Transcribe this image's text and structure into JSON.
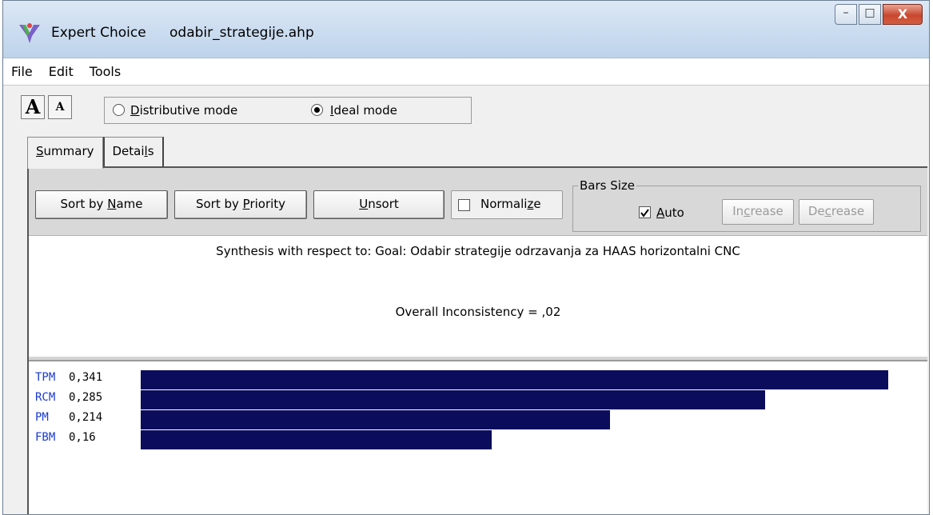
{
  "window": {
    "app_name": "Expert Choice",
    "file_name": "odabir_strategije.ahp",
    "minimize_glyph": "–",
    "maximize_glyph": "□",
    "close_glyph": "X"
  },
  "menu": [
    "File",
    "Edit",
    "Tools"
  ],
  "toolbar": {
    "font_increase": "A",
    "font_decrease": "A",
    "modes": [
      {
        "label": "Distributive mode",
        "selected": false
      },
      {
        "label": "Ideal mode",
        "selected": true
      }
    ]
  },
  "tabs": [
    {
      "label": "Summary",
      "active": true
    },
    {
      "label": "Details",
      "active": false
    }
  ],
  "controls": {
    "sort_name": "Sort by Name",
    "sort_priority": "Sort by Priority",
    "unsort": "Unsort",
    "normalize": "Normalize",
    "normalize_checked": false,
    "bars_size": {
      "legend": "Bars Size",
      "auto": "Auto",
      "auto_checked": true,
      "increase": "Increase",
      "decrease": "Decrease"
    }
  },
  "synthesis": {
    "title": "Synthesis with respect to: Goal: Odabir strategije odrzavanja za HAAS horizontalni CNC",
    "inconsistency": "Overall Inconsistency = ,02"
  },
  "results": [
    {
      "name": "TPM",
      "value_label": "0,341",
      "value": 0.341
    },
    {
      "name": "RCM",
      "value_label": "0,285",
      "value": 0.285
    },
    {
      "name": "PM",
      "value_label": "0,214",
      "value": 0.214
    },
    {
      "name": "FBM",
      "value_label": "0,16",
      "value": 0.16
    }
  ],
  "colors": {
    "bar": "#0c0c5c",
    "alternative_name": "#1a3ad0"
  }
}
